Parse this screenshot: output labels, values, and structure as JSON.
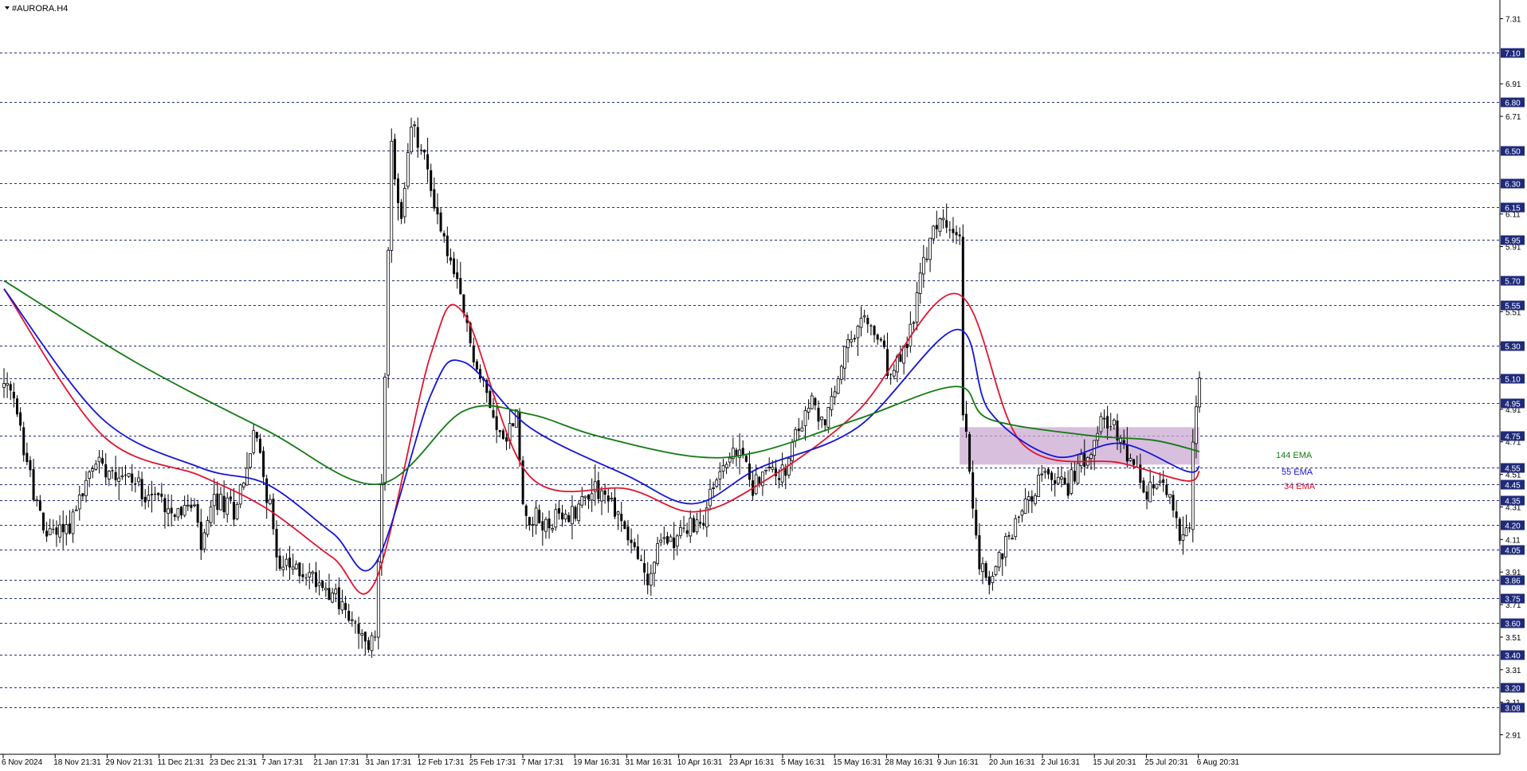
{
  "symbol_label": "#AURORA.H4",
  "colors": {
    "background": "#ffffff",
    "candle": "#000000",
    "grid": "#1f2a7a",
    "price_box": "#1f2a7a",
    "ema34": "#e0142e",
    "ema55": "#1515d6",
    "ema144": "#127a12",
    "zone": "#c9a9d1"
  },
  "chart_data": {
    "type": "candlestick",
    "title": "#AURORA.H4",
    "ylim": [
      2.8,
      7.42
    ],
    "x_tick_labels": [
      "6 Nov 2024",
      "18 Nov 21:31",
      "29 Nov 21:31",
      "11 Dec 21:31",
      "23 Dec 21:31",
      "7 Jan 17:31",
      "21 Jan 17:31",
      "31 Jan 17:31",
      "12 Feb 17:31",
      "25 Feb 17:31",
      "7 Mar 17:31",
      "19 Mar 16:31",
      "31 Mar 16:31",
      "10 Apr 16:31",
      "23 Apr 16:31",
      "5 May 16:31",
      "15 May 16:31",
      "28 May 16:31",
      "9 Jun 16:31",
      "20 Jun 16:31",
      "2 Jul 16:31",
      "15 Jul 20:31",
      "25 Jul 20:31",
      "6 Aug 20:31"
    ],
    "y_tick_labels": [
      "7.31",
      "6.91",
      "6.71",
      "6.11",
      "5.91",
      "5.51",
      "5.31",
      "5.11",
      "4.91",
      "4.71",
      "4.51",
      "4.31",
      "4.11",
      "3.91",
      "3.71",
      "3.51",
      "3.31",
      "3.11",
      "2.91"
    ],
    "levels": [
      "7.10",
      "6.80",
      "6.50",
      "6.30",
      "6.15",
      "5.95",
      "5.70",
      "5.55",
      "5.30",
      "5.10",
      "4.95",
      "4.75",
      "4.55",
      "4.45",
      "4.35",
      "4.20",
      "4.05",
      "3.86",
      "3.75",
      "3.60",
      "3.40",
      "3.20",
      "3.08"
    ],
    "anchors": [
      [
        0,
        5.05
      ],
      [
        3,
        4.95
      ],
      [
        8,
        4.5
      ],
      [
        12,
        4.15
      ],
      [
        20,
        4.2
      ],
      [
        28,
        4.6
      ],
      [
        36,
        4.52
      ],
      [
        44,
        4.4
      ],
      [
        52,
        4.3
      ],
      [
        58,
        4.3
      ],
      [
        60,
        4.05
      ],
      [
        64,
        4.35
      ],
      [
        70,
        4.3
      ],
      [
        74,
        4.55
      ],
      [
        76,
        4.75
      ],
      [
        78,
        4.65
      ],
      [
        80,
        4.4
      ],
      [
        84,
        3.95
      ],
      [
        92,
        3.9
      ],
      [
        100,
        3.8
      ],
      [
        110,
        3.45
      ],
      [
        113,
        3.5
      ],
      [
        115,
        4.5
      ],
      [
        118,
        6.5
      ],
      [
        121,
        6.05
      ],
      [
        124,
        6.65
      ],
      [
        128,
        6.45
      ],
      [
        132,
        6.1
      ],
      [
        136,
        5.8
      ],
      [
        140,
        5.5
      ],
      [
        144,
        5.15
      ],
      [
        148,
        4.95
      ],
      [
        152,
        4.7
      ],
      [
        156,
        4.88
      ],
      [
        158,
        4.3
      ],
      [
        164,
        4.2
      ],
      [
        172,
        4.25
      ],
      [
        180,
        4.45
      ],
      [
        186,
        4.3
      ],
      [
        192,
        4.05
      ],
      [
        196,
        3.85
      ],
      [
        200,
        4.1
      ],
      [
        206,
        4.15
      ],
      [
        212,
        4.2
      ],
      [
        218,
        4.55
      ],
      [
        224,
        4.65
      ],
      [
        228,
        4.45
      ],
      [
        234,
        4.55
      ],
      [
        238,
        4.5
      ],
      [
        242,
        4.8
      ],
      [
        246,
        4.95
      ],
      [
        250,
        4.8
      ],
      [
        256,
        5.25
      ],
      [
        262,
        5.45
      ],
      [
        266,
        5.35
      ],
      [
        270,
        5.1
      ],
      [
        275,
        5.3
      ],
      [
        280,
        5.8
      ],
      [
        285,
        6.1
      ],
      [
        289,
        5.95
      ],
      [
        291,
        6.0
      ],
      [
        292,
        4.9
      ],
      [
        294,
        4.55
      ],
      [
        297,
        3.95
      ],
      [
        300,
        3.85
      ],
      [
        304,
        4.05
      ],
      [
        310,
        4.3
      ],
      [
        316,
        4.5
      ],
      [
        324,
        4.45
      ],
      [
        330,
        4.65
      ],
      [
        334,
        4.9
      ],
      [
        340,
        4.7
      ],
      [
        344,
        4.55
      ],
      [
        348,
        4.35
      ],
      [
        352,
        4.5
      ],
      [
        356,
        4.35
      ],
      [
        358,
        4.08
      ],
      [
        361,
        4.15
      ],
      [
        362,
        4.7
      ],
      [
        364,
        5.1
      ]
    ],
    "n_candles": 365,
    "ema_series": [
      {
        "name": "34 EMA",
        "period": 34,
        "x": [
          0,
          30,
          60,
          80,
          100,
          113,
          130,
          140,
          160,
          190,
          210,
          230,
          260,
          290,
          310,
          340,
          360,
          364
        ],
        "y": [
          5.65,
          4.75,
          4.5,
          4.3,
          4.0,
          3.85,
          5.25,
          5.5,
          4.5,
          4.42,
          4.28,
          4.45,
          4.9,
          5.62,
          4.7,
          4.58,
          4.47,
          4.53
        ]
      },
      {
        "name": "55 EMA",
        "period": 55,
        "x": [
          0,
          30,
          60,
          80,
          100,
          113,
          130,
          140,
          160,
          190,
          210,
          230,
          260,
          290,
          300,
          320,
          340,
          360,
          364
        ],
        "y": [
          5.65,
          4.85,
          4.55,
          4.45,
          4.15,
          3.96,
          5.0,
          5.2,
          4.8,
          4.5,
          4.33,
          4.55,
          4.8,
          5.4,
          4.9,
          4.62,
          4.7,
          4.53,
          4.56
        ]
      },
      {
        "name": "144 EMA",
        "period": 144,
        "x": [
          0,
          40,
          80,
          114,
          140,
          160,
          180,
          210,
          230,
          260,
          290,
          300,
          330,
          350,
          364
        ],
        "y": [
          5.7,
          5.2,
          4.78,
          4.45,
          4.9,
          4.88,
          4.75,
          4.62,
          4.65,
          4.85,
          5.05,
          4.85,
          4.75,
          4.72,
          4.65
        ]
      }
    ],
    "zone": {
      "x_start": 291,
      "x_end": 364,
      "y_low": 4.57,
      "y_high": 4.8
    },
    "legend": [
      "144 EMA",
      "55 EMA",
      "34 EMA"
    ]
  }
}
